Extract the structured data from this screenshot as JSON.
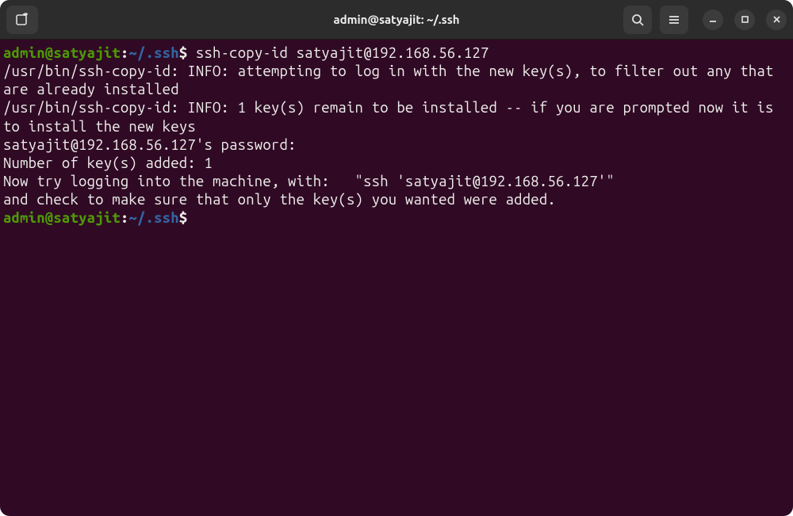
{
  "titlebar": {
    "title": "admin@satyajit: ~/.ssh"
  },
  "prompt": {
    "user_host": "admin@satyajit",
    "colon": ":",
    "path": "~/.ssh",
    "symbol": "$"
  },
  "command1": " ssh-copy-id satyajit@192.168.56.127",
  "output": {
    "l1": "/usr/bin/ssh-copy-id: INFO: attempting to log in with the new key(s), to filter out any that are already installed",
    "l2": "/usr/bin/ssh-copy-id: INFO: 1 key(s) remain to be installed -- if you are prompted now it is to install the new keys",
    "l3": "satyajit@192.168.56.127's password:",
    "blank1": "",
    "l4": "Number of key(s) added: 1",
    "blank2": "",
    "l5": "Now try logging into the machine, with:   \"ssh 'satyajit@192.168.56.127'\"",
    "l6": "and check to make sure that only the key(s) you wanted were added.",
    "blank3": ""
  },
  "command2": " "
}
